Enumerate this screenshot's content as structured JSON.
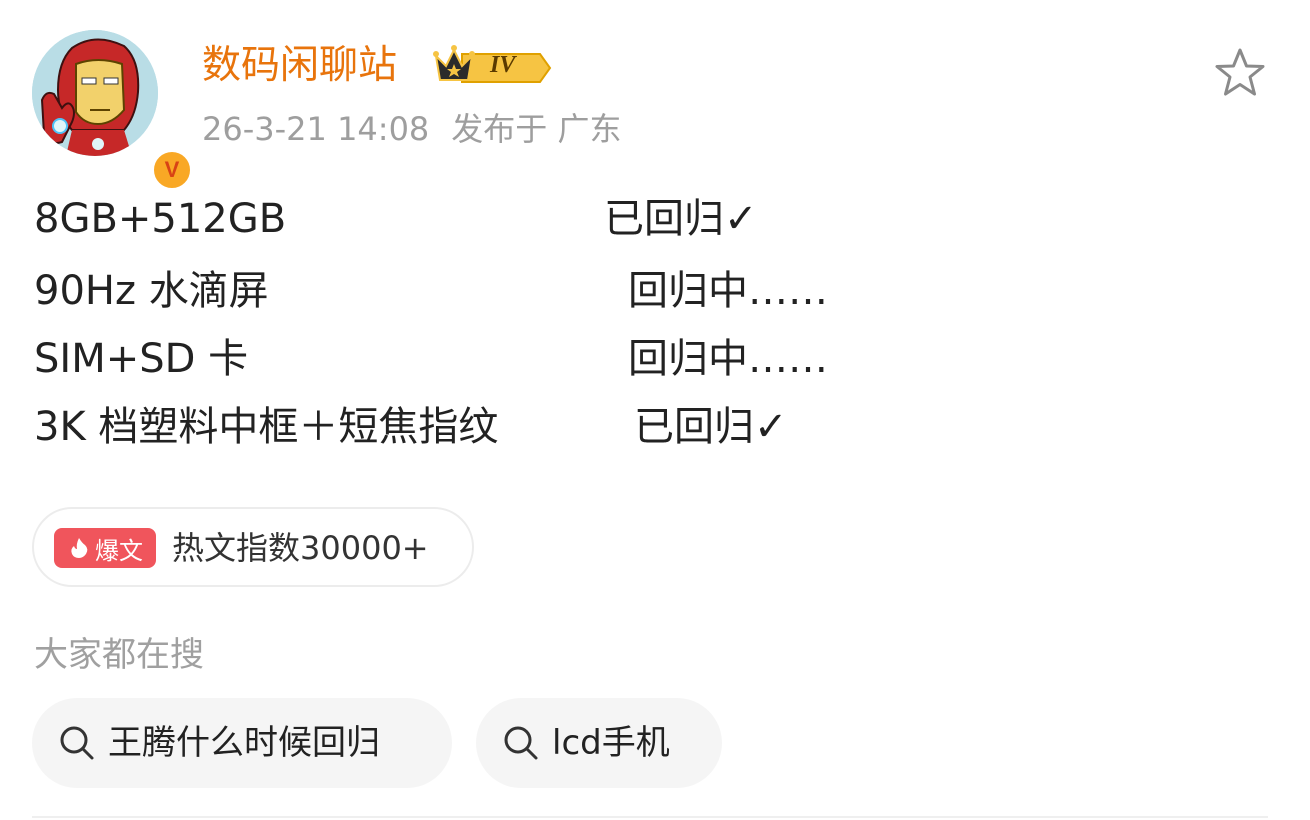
{
  "header": {
    "user_name": "数码闲聊站",
    "level": "IV",
    "verified_mark": "V",
    "timestamp": "26-3-21 14:08",
    "location": "发布于 广东",
    "avatar_icon": "iron-man-avatar",
    "favorite_icon": "star-outline-icon",
    "name_color": "#e8740c"
  },
  "post": {
    "lines": [
      {
        "spec": "8GB+512GB",
        "status": "已回归✓"
      },
      {
        "spec": "90Hz 水滴屏",
        "status": "回归中……"
      },
      {
        "spec": "SIM+SD 卡",
        "status": "回归中……"
      },
      {
        "spec": "3K 档塑料中框＋短焦指纹",
        "status": "已回归✓"
      }
    ]
  },
  "hot": {
    "tag": "爆文",
    "text": "热文指数30000+",
    "tag_color": "#f0555c"
  },
  "searches": {
    "heading": "大家都在搜",
    "items": [
      {
        "label": "王腾什么时候回归"
      },
      {
        "label": "lcd手机"
      }
    ]
  }
}
